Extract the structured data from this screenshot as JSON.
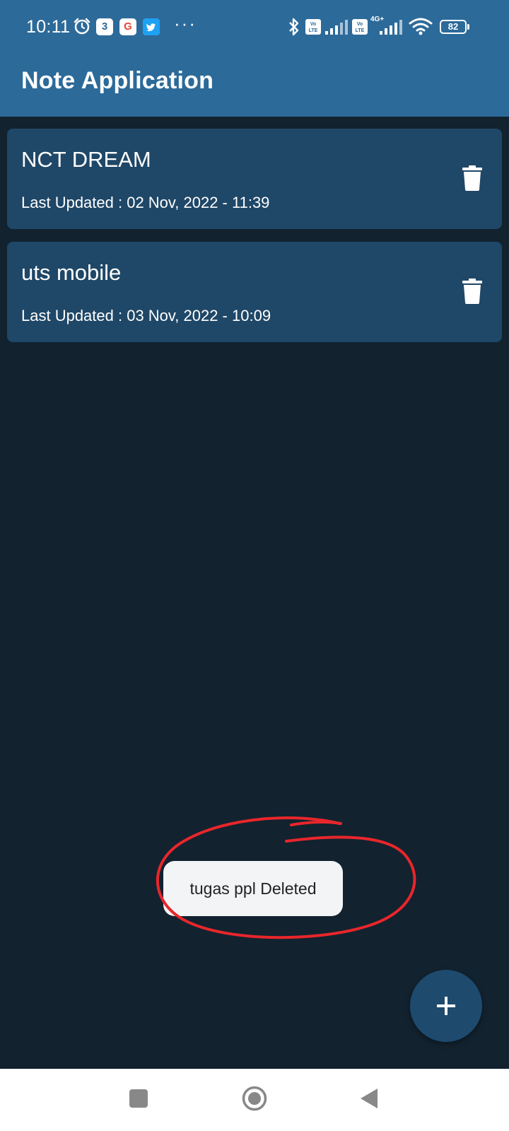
{
  "status_bar": {
    "time": "10:11",
    "calendar_badge": "3",
    "google_badge": "G",
    "more_indicator": "···",
    "volte_label": "Vo LTE",
    "network_type": "4G+",
    "battery_level": "82",
    "icons": [
      "alarm-icon",
      "calendar-icon",
      "google-icon",
      "twitter-icon",
      "bluetooth-icon",
      "signal-icon",
      "wifi-icon",
      "battery-icon"
    ]
  },
  "app_bar": {
    "title": "Note Application",
    "color": "#2C6A99"
  },
  "notes": [
    {
      "title": "NCT DREAM",
      "updated": "Last Updated : 02 Nov, 2022 - 11:39"
    },
    {
      "title": "uts mobile",
      "updated": "Last Updated : 03 Nov, 2022 - 10:09"
    }
  ],
  "toast": {
    "message": "tugas ppl Deleted"
  },
  "fab": {
    "icon": "plus-icon"
  },
  "nav_bar": {
    "buttons": [
      "recent-apps-icon",
      "home-icon",
      "back-icon"
    ]
  },
  "colors": {
    "background": "#12222F",
    "card": "#1F4767",
    "fab": "#1E4A6E",
    "annotation": "#E8262B"
  }
}
